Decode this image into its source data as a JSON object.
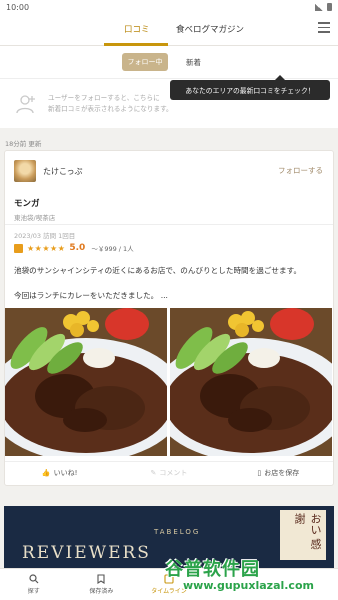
{
  "status_bar": {
    "time": "10:00"
  },
  "top_nav": {
    "tabs": [
      {
        "label": "口コミ"
      },
      {
        "label": "食べログマガジン"
      }
    ]
  },
  "sub_tabs": {
    "follow_label": "フォロー中",
    "new_label": "新着"
  },
  "tooltip": {
    "text": "あなたのエリアの最新口コミをチェック！"
  },
  "follow_hint": {
    "line1": "ユーザーをフォローすると、こちらに",
    "line2": "新着口コミが表示されるようになります。"
  },
  "updated_label": "18分前 更新",
  "review": {
    "username": "たけこっぷ",
    "follow_label": "フォローする",
    "shop_name": "モンガ",
    "shop_area": "東池袋/喫茶店",
    "visit": "2023/03 訪問 1回目",
    "stars": "★★★★★",
    "score": "5.0",
    "price": "～￥999 / 1人",
    "text_line1": "池袋のサンシャインシティの近くにあるお店で、のんびりとした時間を過ごせます。",
    "text_line2": "今回はランチにカレーをいただきました。 ...",
    "actions": {
      "like": "いいね!",
      "comment": "コメント",
      "save": "お店を保存"
    }
  },
  "banner": {
    "logo": "TABELOG",
    "title": "REVIEWERS",
    "jp": "おい 感謝"
  },
  "bottom_nav": [
    {
      "label": "探す"
    },
    {
      "label": "保存済み"
    },
    {
      "label": "タイムライン"
    }
  ],
  "watermark": {
    "title": "谷普软件园",
    "url": "www.gupuxlazal.com"
  },
  "colors": {
    "accent": "#c8960c",
    "star": "#e89d1c",
    "score": "#e07a1f",
    "banner_bg": "#1a2a43"
  }
}
